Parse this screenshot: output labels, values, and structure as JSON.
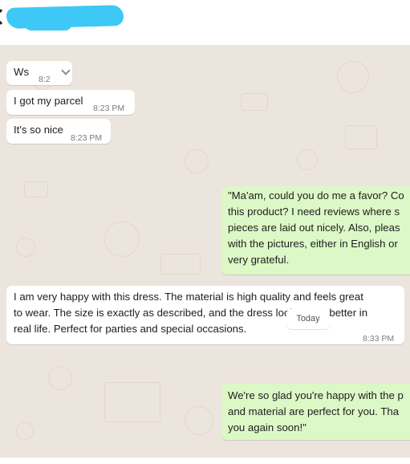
{
  "header": {
    "redacted_contact": "",
    "back_icon": "back-arrow-icon"
  },
  "messages": [
    {
      "text": "Ws",
      "time": "8:2",
      "dir": "in"
    },
    {
      "text": "I got my parcel",
      "time": "8:23 PM",
      "dir": "in"
    },
    {
      "text": "It's so nice",
      "time": "8:23 PM",
      "dir": "in"
    },
    {
      "lines": [
        "\"Ma'am, could you do me a favor? Co",
        "this product? I need reviews where s",
        "pieces are laid out nicely. Also, pleas",
        "with the pictures, either in English or",
        "very grateful."
      ],
      "dir": "out"
    },
    {
      "lines": [
        "I am very happy with this dress. The material is high quality and feels great",
        "to wear. The size is exactly as described, and the dress looks even better in",
        "real life. Perfect for parties and special occasions."
      ],
      "time": "8:33 PM",
      "dir": "in"
    },
    {
      "lines": [
        "We're so glad you're happy with the p",
        "and material are perfect for you. Tha",
        "you again soon!\""
      ],
      "dir": "out"
    }
  ],
  "date_separator": "Today",
  "colors": {
    "chat_background": "#ece5dd",
    "incoming_bubble": "#ffffff",
    "outgoing_bubble": "#dcf8c6",
    "redaction": "#3ec8f5"
  }
}
